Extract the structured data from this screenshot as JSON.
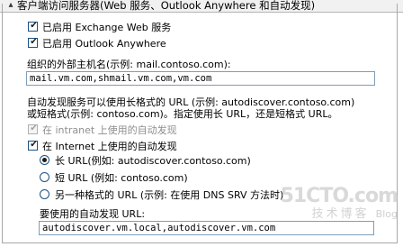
{
  "section": {
    "title": "客户端访问服务器(Web 服务、Outlook Anywhere 和自动发现)",
    "chevron_icon": "chevron-up-icon"
  },
  "options": {
    "exchange_web_services": {
      "label": "已启用 Exchange Web 服务",
      "checked": true
    },
    "outlook_anywhere": {
      "label": "已启用 Outlook Anywhere",
      "checked": true
    }
  },
  "external_host": {
    "label": "组织的外部主机名(示例: mail.contoso.com):",
    "value": "mail.vm.com,shmail.vm.com,vm.com"
  },
  "autodiscover_desc": {
    "line1": "自动发现服务可以使用长格式的 URL (示例: autodiscover.contoso.com)",
    "line2": "或短格式(示例: contoso.com)。指定使用长 URL，还是短格式 URL。"
  },
  "intranet_autodiscover": {
    "label": "在 intranet 上使用的自动发现",
    "checked": true,
    "enabled": false
  },
  "internet_autodiscover": {
    "label": "在 Internet 上使用的自动发现",
    "checked": true
  },
  "url_format": {
    "long": {
      "label": "长 URL(例如: autodiscover.contoso.com)",
      "selected": true
    },
    "short": {
      "label": "短 URL (例如: contoso.com)",
      "selected": false
    },
    "alternate": {
      "label": "另一种格式的 URL (示例: 在使用 DNS SRV 方法时)",
      "selected": false
    }
  },
  "autodiscover_url": {
    "label": "要使用的自动发现 URL:",
    "value": "autodiscover.vm.local,autodiscover.vm.com"
  },
  "watermark": {
    "site": "51CTO.com",
    "sub": "技术博客",
    "blog": "Blog"
  }
}
